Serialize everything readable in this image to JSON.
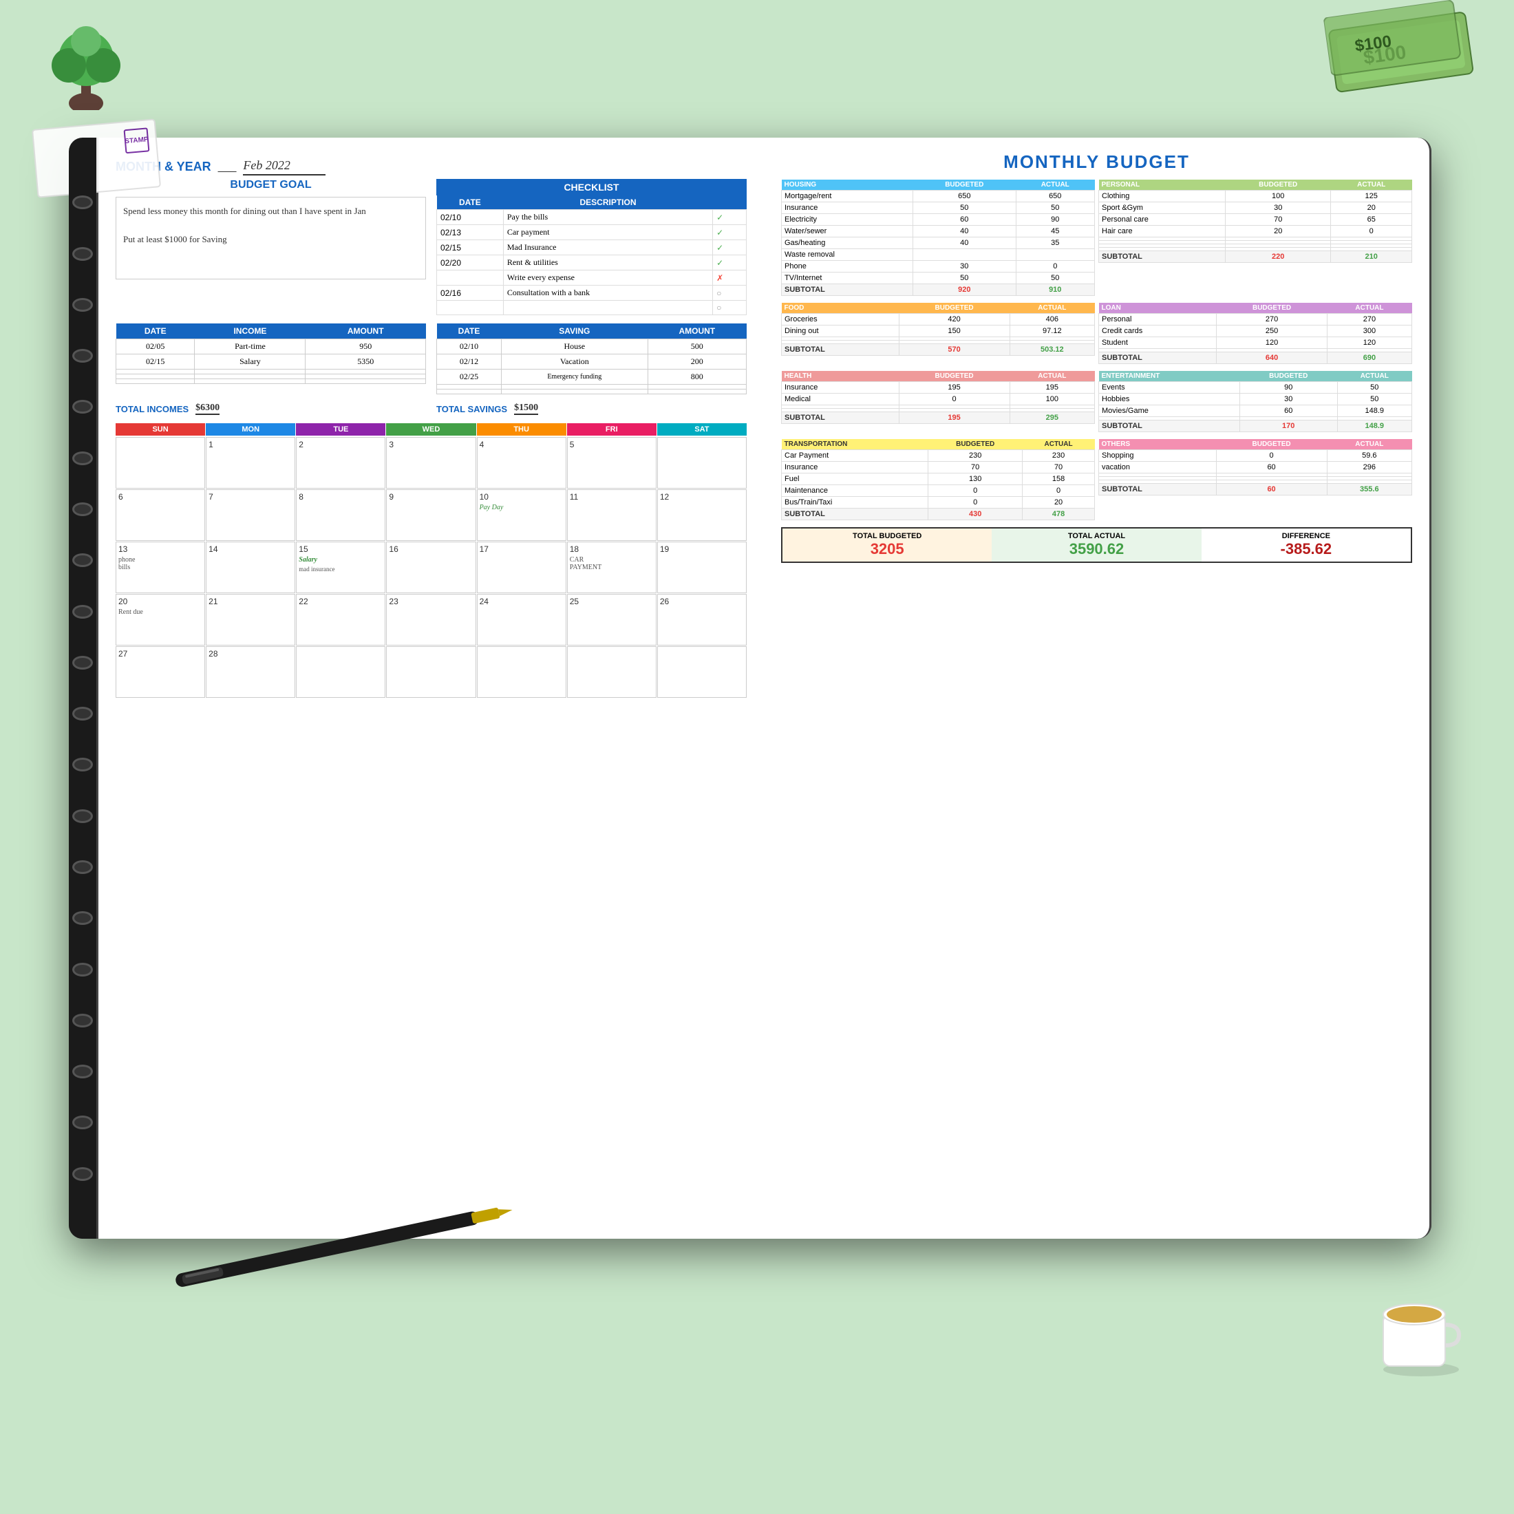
{
  "page": {
    "month_label": "MONTH & YEAR",
    "month_value": "Feb 2022",
    "budget_goal_label": "BUDGET GOAL",
    "budget_goal_text1": "Spend less money this month for dining out than I have spent in Jan",
    "budget_goal_text2": "Put at least $1000 for Saving",
    "checklist_label": "CHECKLIST",
    "checklist_headers": [
      "DATE",
      "DESCRIPTION"
    ],
    "checklist_items": [
      {
        "date": "02/10",
        "desc": "Pay the bills",
        "status": "done"
      },
      {
        "date": "02/13",
        "desc": "Car payment",
        "status": "done"
      },
      {
        "date": "02/15",
        "desc": "Mad Insurance",
        "status": "done"
      },
      {
        "date": "02/20",
        "desc": "Rent & utilities",
        "status": "done"
      },
      {
        "date": "",
        "desc": "Write every expense",
        "status": "x"
      },
      {
        "date": "02/16",
        "desc": "Consultation with a bank",
        "status": "empty"
      },
      {
        "date": "",
        "desc": "",
        "status": "empty"
      }
    ],
    "income_headers": [
      "DATE",
      "INCOME",
      "AMOUNT"
    ],
    "income_rows": [
      {
        "date": "02/05",
        "income": "Part-time",
        "amount": "950"
      },
      {
        "date": "02/15",
        "income": "Salary",
        "amount": "5350"
      },
      {
        "date": "",
        "income": "",
        "amount": ""
      },
      {
        "date": "",
        "income": "",
        "amount": ""
      },
      {
        "date": "",
        "income": "",
        "amount": ""
      }
    ],
    "total_incomes_label": "TOTAL INCOMES",
    "total_incomes_value": "$6300",
    "saving_headers": [
      "DATE",
      "SAVING",
      "AMOUNT"
    ],
    "saving_rows": [
      {
        "date": "02/10",
        "saving": "House",
        "amount": "500"
      },
      {
        "date": "02/12",
        "saving": "Vacation",
        "amount": "200"
      },
      {
        "date": "02/25",
        "saving": "Emergency funding",
        "amount": "800"
      },
      {
        "date": "",
        "saving": "",
        "amount": ""
      },
      {
        "date": "",
        "saving": "",
        "amount": ""
      }
    ],
    "total_savings_label": "TOTAL SAVINGS",
    "total_savings_value": "$1500",
    "calendar": {
      "day_names": [
        "SUN",
        "MON",
        "TUE",
        "WED",
        "THU",
        "FRI",
        "SAT"
      ],
      "day_colors": [
        "#e53935",
        "#1e88e5",
        "#8e24aa",
        "#43a047",
        "#fb8c00",
        "#e91e63",
        "#00acc1"
      ],
      "cells": [
        {
          "num": "",
          "note": ""
        },
        {
          "num": "1",
          "note": ""
        },
        {
          "num": "2",
          "note": ""
        },
        {
          "num": "3",
          "note": ""
        },
        {
          "num": "4",
          "note": ""
        },
        {
          "num": "5",
          "note": ""
        },
        {
          "num": "",
          "note": ""
        },
        {
          "num": "6",
          "note": ""
        },
        {
          "num": "7",
          "note": ""
        },
        {
          "num": "8",
          "note": ""
        },
        {
          "num": "9",
          "note": ""
        },
        {
          "num": "10",
          "note": "Pay Day",
          "note_style": "green"
        },
        {
          "num": "11",
          "note": ""
        },
        {
          "num": "12",
          "note": ""
        },
        {
          "num": "13",
          "note": "phone\nbills",
          "note_style": "normal"
        },
        {
          "num": "14",
          "note": ""
        },
        {
          "num": "15",
          "note": "Salary",
          "note_style": "green",
          "note2": "mad insurance"
        },
        {
          "num": "16",
          "note": ""
        },
        {
          "num": "17",
          "note": ""
        },
        {
          "num": "18",
          "note": "CAR\nPAYMENT",
          "note_style": "normal"
        },
        {
          "num": "19",
          "note": ""
        },
        {
          "num": "20",
          "note": "Rent due",
          "note_style": "normal"
        },
        {
          "num": "21",
          "note": ""
        },
        {
          "num": "22",
          "note": ""
        },
        {
          "num": "23",
          "note": ""
        },
        {
          "num": "24",
          "note": ""
        },
        {
          "num": "25",
          "note": ""
        },
        {
          "num": "26",
          "note": ""
        },
        {
          "num": "27",
          "note": ""
        },
        {
          "num": "28",
          "note": ""
        },
        {
          "num": "",
          "note": ""
        },
        {
          "num": "",
          "note": ""
        },
        {
          "num": "",
          "note": ""
        },
        {
          "num": "",
          "note": ""
        },
        {
          "num": "",
          "note": ""
        }
      ]
    },
    "monthly_budget_title": "MONTHLY BUDGET",
    "sections": {
      "housing": {
        "label": "HOUSING",
        "col_budgeted": "BUDGETED",
        "col_actual": "ACTUAL",
        "rows": [
          {
            "name": "Mortgage/rent",
            "budgeted": "650",
            "actual": "650"
          },
          {
            "name": "Insurance",
            "budgeted": "50",
            "actual": "50"
          },
          {
            "name": "Electricity",
            "budgeted": "60",
            "actual": "90"
          },
          {
            "name": "Water/sewer",
            "budgeted": "40",
            "actual": "45"
          },
          {
            "name": "Gas/heating",
            "budgeted": "40",
            "actual": "35"
          },
          {
            "name": "Waste removal",
            "budgeted": "",
            "actual": ""
          },
          {
            "name": "Phone",
            "budgeted": "30",
            "actual": "0"
          },
          {
            "name": "TV/Internet",
            "budgeted": "50",
            "actual": "50"
          }
        ],
        "subtotal_budgeted": "920",
        "subtotal_actual": "910"
      },
      "personal": {
        "label": "PERSONAL",
        "rows": [
          {
            "name": "Clothing",
            "budgeted": "100",
            "actual": "125"
          },
          {
            "name": "Sport &Gym",
            "budgeted": "30",
            "actual": "20"
          },
          {
            "name": "Personal care",
            "budgeted": "70",
            "actual": "65"
          },
          {
            "name": "Hair care",
            "budgeted": "20",
            "actual": "0"
          },
          {
            "name": "",
            "budgeted": "",
            "actual": ""
          },
          {
            "name": "",
            "budgeted": "",
            "actual": ""
          },
          {
            "name": "",
            "budgeted": "",
            "actual": ""
          },
          {
            "name": "",
            "budgeted": "",
            "actual": ""
          }
        ],
        "subtotal_budgeted": "220",
        "subtotal_actual": "210"
      },
      "food": {
        "label": "FOOD",
        "rows": [
          {
            "name": "Groceries",
            "budgeted": "420",
            "actual": "406"
          },
          {
            "name": "Dining out",
            "budgeted": "150",
            "actual": "97.12"
          },
          {
            "name": "",
            "budgeted": "",
            "actual": ""
          },
          {
            "name": "",
            "budgeted": "",
            "actual": ""
          }
        ],
        "subtotal_budgeted": "570",
        "subtotal_actual": "503.12"
      },
      "loan": {
        "label": "LOAN",
        "rows": [
          {
            "name": "Personal",
            "budgeted": "270",
            "actual": "270"
          },
          {
            "name": "Credit cards",
            "budgeted": "250",
            "actual": "300"
          },
          {
            "name": "Student",
            "budgeted": "120",
            "actual": "120"
          },
          {
            "name": "",
            "budgeted": "",
            "actual": ""
          }
        ],
        "subtotal_budgeted": "640",
        "subtotal_actual": "690"
      },
      "health": {
        "label": "HEALTH",
        "rows": [
          {
            "name": "Insurance",
            "budgeted": "195",
            "actual": "195"
          },
          {
            "name": "Medical",
            "budgeted": "0",
            "actual": "100"
          },
          {
            "name": "",
            "budgeted": "",
            "actual": ""
          },
          {
            "name": "",
            "budgeted": "",
            "actual": ""
          }
        ],
        "subtotal_budgeted": "195",
        "subtotal_actual": "295"
      },
      "entertainment": {
        "label": "ENTERTAINMENT",
        "rows": [
          {
            "name": "Events",
            "budgeted": "90",
            "actual": "50"
          },
          {
            "name": "Hobbies",
            "budgeted": "30",
            "actual": "50"
          },
          {
            "name": "Movies/Game",
            "budgeted": "60",
            "actual": "148.9"
          },
          {
            "name": "",
            "budgeted": "",
            "actual": ""
          }
        ],
        "subtotal_budgeted": "170",
        "subtotal_actual": "148.9"
      },
      "transportation": {
        "label": "TRANSPORTATION",
        "rows": [
          {
            "name": "Car Payment",
            "budgeted": "230",
            "actual": "230"
          },
          {
            "name": "Insurance",
            "budgeted": "70",
            "actual": "70"
          },
          {
            "name": "Fuel",
            "budgeted": "130",
            "actual": "158"
          },
          {
            "name": "Maintenance",
            "budgeted": "0",
            "actual": "0"
          },
          {
            "name": "Bus/Train/Taxi",
            "budgeted": "0",
            "actual": "20"
          }
        ],
        "subtotal_budgeted": "430",
        "subtotal_actual": "478"
      },
      "others": {
        "label": "OTHERS",
        "rows": [
          {
            "name": "Shopping",
            "budgeted": "0",
            "actual": "59.6"
          },
          {
            "name": "vacation",
            "budgeted": "60",
            "actual": "296"
          },
          {
            "name": "",
            "budgeted": "",
            "actual": ""
          },
          {
            "name": "",
            "budgeted": "",
            "actual": ""
          },
          {
            "name": "",
            "budgeted": "",
            "actual": ""
          }
        ],
        "subtotal_budgeted": "60",
        "subtotal_actual": "355.6"
      }
    },
    "totals": {
      "budgeted_label": "TOTAL BUDGETED",
      "budgeted_value": "3205",
      "actual_label": "TOTAL ACTUAL",
      "actual_value": "3590.62",
      "difference_label": "DIFFERENCE",
      "difference_value": "-385.62"
    }
  }
}
